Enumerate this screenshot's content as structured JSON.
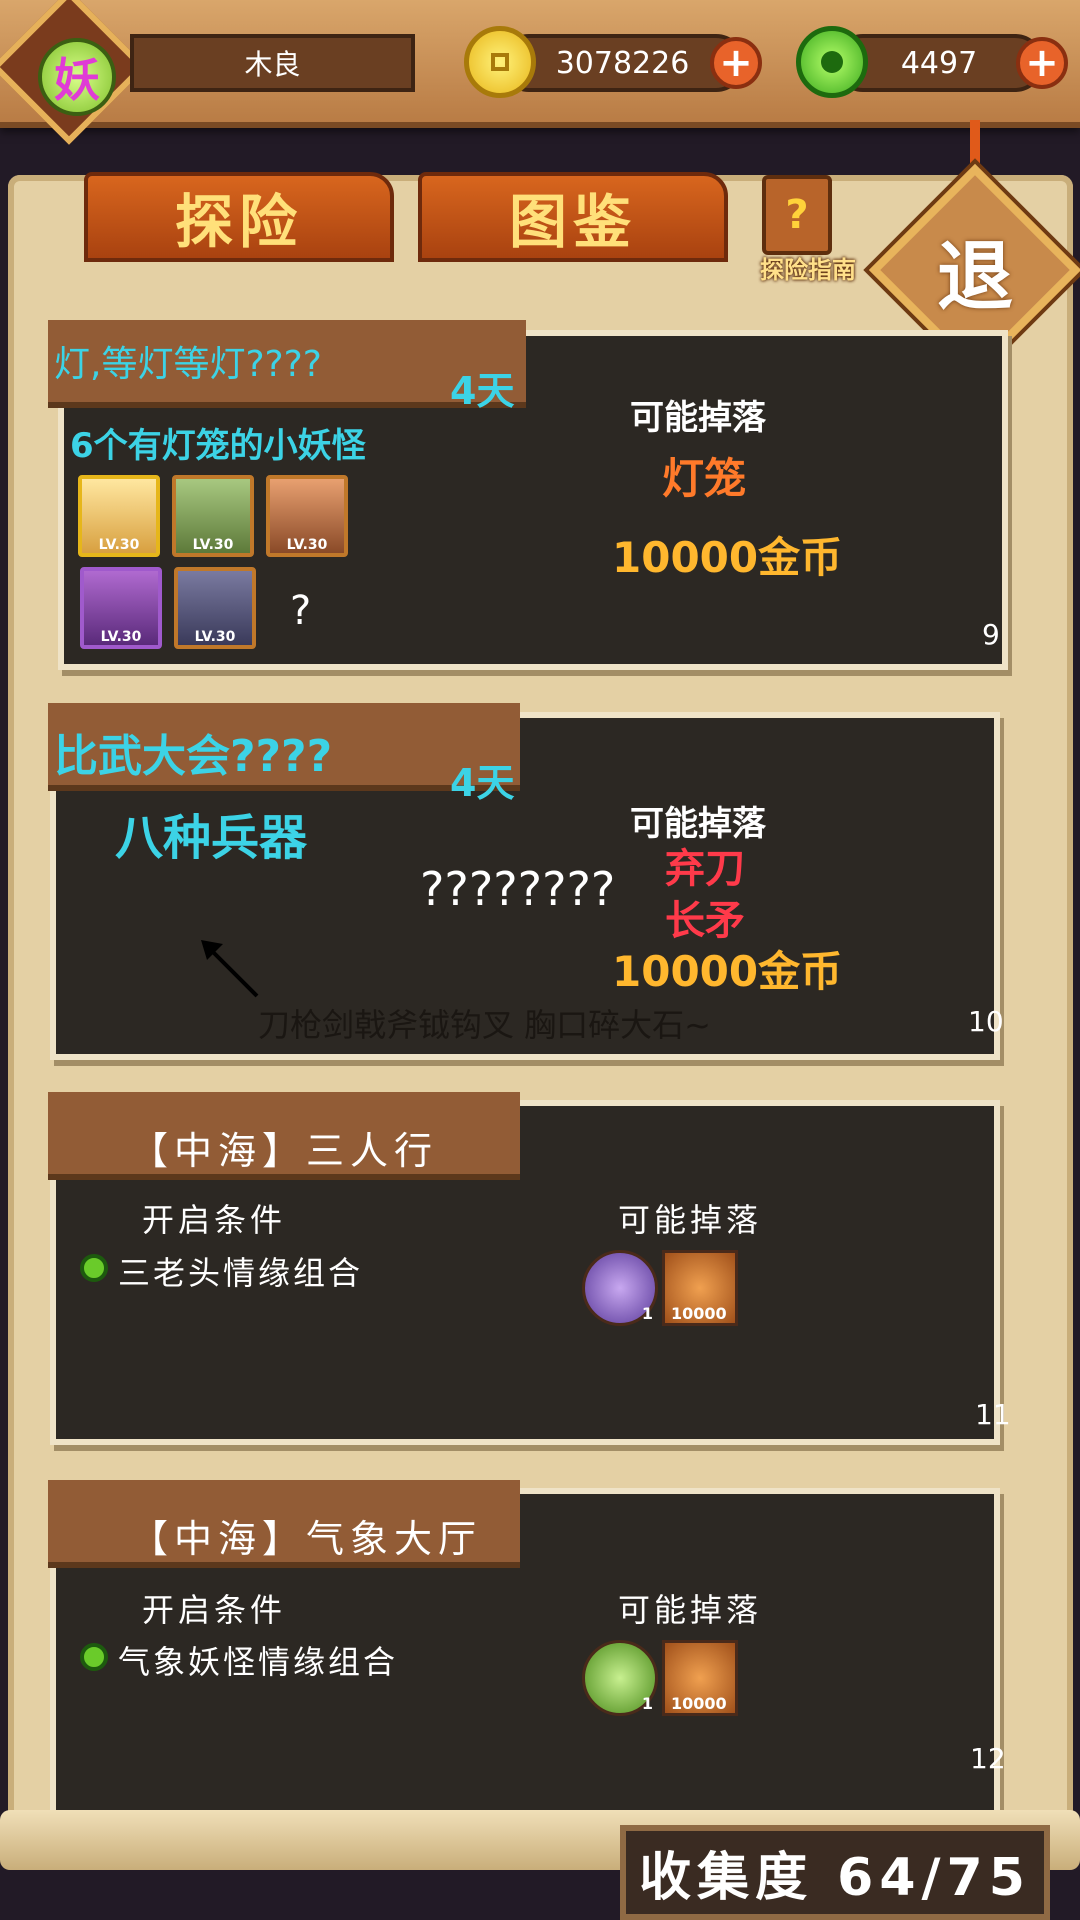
{
  "player": {
    "avatar_char": "妖",
    "name": "木良"
  },
  "resources": {
    "gold": "3078226",
    "jade": "4497",
    "plus": "+"
  },
  "tabs": {
    "explore": "探险",
    "compendium": "图鉴"
  },
  "guide": {
    "label": "探险指南",
    "glyph": "?"
  },
  "exit": {
    "label": "退"
  },
  "cards": [
    {
      "title": "灯,等灯等灯????",
      "days": "4天",
      "subtitle": "6个有灯笼的小妖怪",
      "monster_levels": [
        "LV.30",
        "LV.30",
        "LV.30",
        "LV.30",
        "LV.30"
      ],
      "unknown": "?",
      "drop_header": "可能掉落",
      "drops": [
        "灯笼",
        "10000金币"
      ],
      "index": "9"
    },
    {
      "title": "比武大会????",
      "days": "4天",
      "subtitle": "八种兵器",
      "mystery": "????????",
      "drop_header": "可能掉落",
      "drops": [
        "弃刀",
        "长矛",
        "10000金币"
      ],
      "hint": "刀枪剑戟斧钺钩叉 胸口碎大石~",
      "index": "10"
    },
    {
      "title": "【中海】三人行",
      "cond_header": "开启条件",
      "condition": "三老头情缘组合",
      "drop_header": "可能掉落",
      "items": [
        {
          "icon": "hourglass-orb-icon",
          "count": "1"
        },
        {
          "icon": "gold-bag-icon",
          "count": "10000"
        }
      ],
      "index": "11"
    },
    {
      "title": "【中海】气象大厅",
      "cond_header": "开启条件",
      "condition": "气象妖怪情缘组合",
      "drop_header": "可能掉落",
      "items": [
        {
          "icon": "green-wind-orb-icon",
          "count": "1"
        },
        {
          "icon": "gold-bag-icon",
          "count": "10000"
        }
      ],
      "index": "12"
    }
  ],
  "collection": "收集度  64/75"
}
